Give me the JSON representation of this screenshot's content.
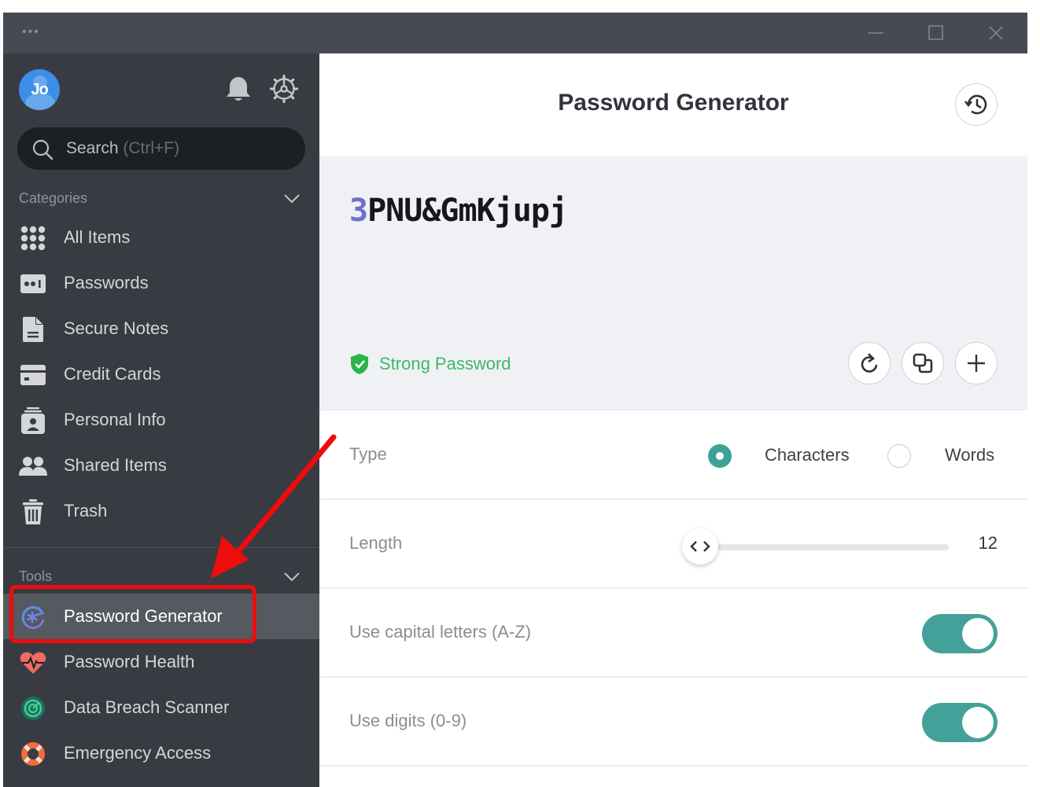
{
  "window": {
    "menu_icon": "more-dots-icon",
    "controls": [
      "minimize",
      "maximize",
      "close"
    ]
  },
  "sidebar": {
    "avatar_initials": "Jo",
    "icons": {
      "notifications": "bell-icon",
      "settings": "gear-icon"
    },
    "search": {
      "label": "Search",
      "hint": "(Ctrl+F)"
    },
    "categories": {
      "title": "Categories",
      "items": [
        {
          "label": "All Items",
          "icon": "grid-icon"
        },
        {
          "label": "Passwords",
          "icon": "password-icon"
        },
        {
          "label": "Secure Notes",
          "icon": "note-icon"
        },
        {
          "label": "Credit Cards",
          "icon": "credit-card-icon"
        },
        {
          "label": "Personal Info",
          "icon": "id-card-icon"
        },
        {
          "label": "Shared Items",
          "icon": "users-icon"
        },
        {
          "label": "Trash",
          "icon": "trash-icon"
        }
      ]
    },
    "tools": {
      "title": "Tools",
      "items": [
        {
          "label": "Password Generator",
          "icon": "generator-icon",
          "active": true
        },
        {
          "label": "Password Health",
          "icon": "heart-pulse-icon"
        },
        {
          "label": "Data Breach Scanner",
          "icon": "radar-icon"
        },
        {
          "label": "Emergency Access",
          "icon": "lifebuoy-icon"
        }
      ]
    }
  },
  "main": {
    "title": "Password Generator",
    "history_icon": "history-icon",
    "password": {
      "first_char": "3",
      "rest": "PNU&GmKjupj"
    },
    "strength": {
      "label": "Strong Password",
      "color": "#3cb86a"
    },
    "actions": [
      "refresh-icon",
      "copy-icon",
      "plus-icon"
    ],
    "type": {
      "label": "Type",
      "options": [
        {
          "label": "Characters",
          "selected": true
        },
        {
          "label": "Words",
          "selected": false
        }
      ]
    },
    "length": {
      "label": "Length",
      "value": "12",
      "fraction": 0.0
    },
    "options": [
      {
        "label": "Use capital letters (A-Z)",
        "enabled": true
      },
      {
        "label": "Use digits (0-9)",
        "enabled": true
      }
    ]
  },
  "colors": {
    "accent": "#43a199",
    "sidebar_bg": "#383b42",
    "titlebar_bg": "#464a52",
    "annotation": "#ee0c0c"
  }
}
